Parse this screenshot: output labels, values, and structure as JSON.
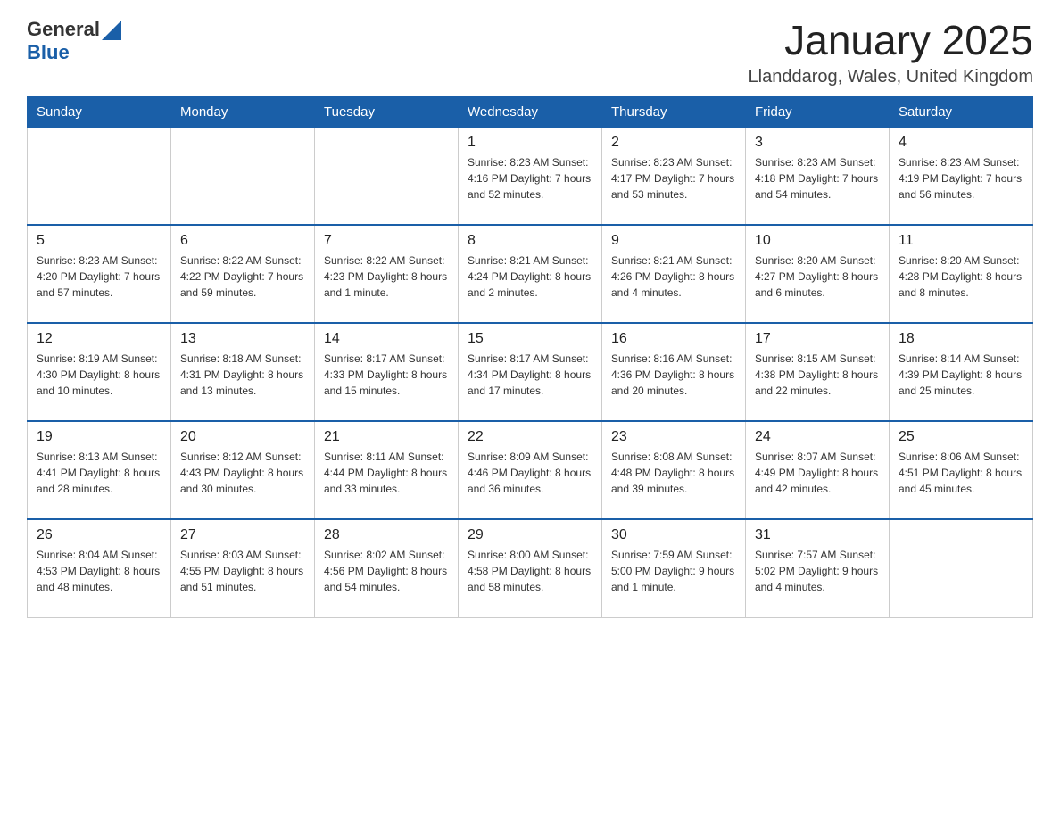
{
  "header": {
    "logo_general": "General",
    "logo_blue": "Blue",
    "title": "January 2025",
    "subtitle": "Llanddarog, Wales, United Kingdom"
  },
  "days_of_week": [
    "Sunday",
    "Monday",
    "Tuesday",
    "Wednesday",
    "Thursday",
    "Friday",
    "Saturday"
  ],
  "weeks": [
    [
      {
        "day": "",
        "info": ""
      },
      {
        "day": "",
        "info": ""
      },
      {
        "day": "",
        "info": ""
      },
      {
        "day": "1",
        "info": "Sunrise: 8:23 AM\nSunset: 4:16 PM\nDaylight: 7 hours\nand 52 minutes."
      },
      {
        "day": "2",
        "info": "Sunrise: 8:23 AM\nSunset: 4:17 PM\nDaylight: 7 hours\nand 53 minutes."
      },
      {
        "day": "3",
        "info": "Sunrise: 8:23 AM\nSunset: 4:18 PM\nDaylight: 7 hours\nand 54 minutes."
      },
      {
        "day": "4",
        "info": "Sunrise: 8:23 AM\nSunset: 4:19 PM\nDaylight: 7 hours\nand 56 minutes."
      }
    ],
    [
      {
        "day": "5",
        "info": "Sunrise: 8:23 AM\nSunset: 4:20 PM\nDaylight: 7 hours\nand 57 minutes."
      },
      {
        "day": "6",
        "info": "Sunrise: 8:22 AM\nSunset: 4:22 PM\nDaylight: 7 hours\nand 59 minutes."
      },
      {
        "day": "7",
        "info": "Sunrise: 8:22 AM\nSunset: 4:23 PM\nDaylight: 8 hours\nand 1 minute."
      },
      {
        "day": "8",
        "info": "Sunrise: 8:21 AM\nSunset: 4:24 PM\nDaylight: 8 hours\nand 2 minutes."
      },
      {
        "day": "9",
        "info": "Sunrise: 8:21 AM\nSunset: 4:26 PM\nDaylight: 8 hours\nand 4 minutes."
      },
      {
        "day": "10",
        "info": "Sunrise: 8:20 AM\nSunset: 4:27 PM\nDaylight: 8 hours\nand 6 minutes."
      },
      {
        "day": "11",
        "info": "Sunrise: 8:20 AM\nSunset: 4:28 PM\nDaylight: 8 hours\nand 8 minutes."
      }
    ],
    [
      {
        "day": "12",
        "info": "Sunrise: 8:19 AM\nSunset: 4:30 PM\nDaylight: 8 hours\nand 10 minutes."
      },
      {
        "day": "13",
        "info": "Sunrise: 8:18 AM\nSunset: 4:31 PM\nDaylight: 8 hours\nand 13 minutes."
      },
      {
        "day": "14",
        "info": "Sunrise: 8:17 AM\nSunset: 4:33 PM\nDaylight: 8 hours\nand 15 minutes."
      },
      {
        "day": "15",
        "info": "Sunrise: 8:17 AM\nSunset: 4:34 PM\nDaylight: 8 hours\nand 17 minutes."
      },
      {
        "day": "16",
        "info": "Sunrise: 8:16 AM\nSunset: 4:36 PM\nDaylight: 8 hours\nand 20 minutes."
      },
      {
        "day": "17",
        "info": "Sunrise: 8:15 AM\nSunset: 4:38 PM\nDaylight: 8 hours\nand 22 minutes."
      },
      {
        "day": "18",
        "info": "Sunrise: 8:14 AM\nSunset: 4:39 PM\nDaylight: 8 hours\nand 25 minutes."
      }
    ],
    [
      {
        "day": "19",
        "info": "Sunrise: 8:13 AM\nSunset: 4:41 PM\nDaylight: 8 hours\nand 28 minutes."
      },
      {
        "day": "20",
        "info": "Sunrise: 8:12 AM\nSunset: 4:43 PM\nDaylight: 8 hours\nand 30 minutes."
      },
      {
        "day": "21",
        "info": "Sunrise: 8:11 AM\nSunset: 4:44 PM\nDaylight: 8 hours\nand 33 minutes."
      },
      {
        "day": "22",
        "info": "Sunrise: 8:09 AM\nSunset: 4:46 PM\nDaylight: 8 hours\nand 36 minutes."
      },
      {
        "day": "23",
        "info": "Sunrise: 8:08 AM\nSunset: 4:48 PM\nDaylight: 8 hours\nand 39 minutes."
      },
      {
        "day": "24",
        "info": "Sunrise: 8:07 AM\nSunset: 4:49 PM\nDaylight: 8 hours\nand 42 minutes."
      },
      {
        "day": "25",
        "info": "Sunrise: 8:06 AM\nSunset: 4:51 PM\nDaylight: 8 hours\nand 45 minutes."
      }
    ],
    [
      {
        "day": "26",
        "info": "Sunrise: 8:04 AM\nSunset: 4:53 PM\nDaylight: 8 hours\nand 48 minutes."
      },
      {
        "day": "27",
        "info": "Sunrise: 8:03 AM\nSunset: 4:55 PM\nDaylight: 8 hours\nand 51 minutes."
      },
      {
        "day": "28",
        "info": "Sunrise: 8:02 AM\nSunset: 4:56 PM\nDaylight: 8 hours\nand 54 minutes."
      },
      {
        "day": "29",
        "info": "Sunrise: 8:00 AM\nSunset: 4:58 PM\nDaylight: 8 hours\nand 58 minutes."
      },
      {
        "day": "30",
        "info": "Sunrise: 7:59 AM\nSunset: 5:00 PM\nDaylight: 9 hours\nand 1 minute."
      },
      {
        "day": "31",
        "info": "Sunrise: 7:57 AM\nSunset: 5:02 PM\nDaylight: 9 hours\nand 4 minutes."
      },
      {
        "day": "",
        "info": ""
      }
    ]
  ]
}
